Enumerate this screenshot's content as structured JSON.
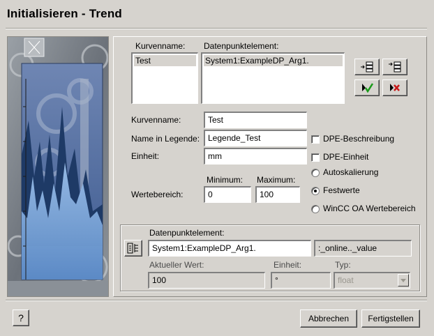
{
  "window": {
    "title": "Initialisieren - Trend"
  },
  "curves": {
    "col_name_label": "Kurvenname:",
    "col_dpe_label": "Datenpunktelement:",
    "name_items": [
      "Test"
    ],
    "dpe_items": [
      "System1:ExampleDP_Arg1."
    ]
  },
  "toolbar": {
    "insert_before_icon": "insert-row-above-icon",
    "insert_after_icon": "insert-row-below-icon",
    "accept_icon": "checkmark-icon",
    "delete_icon": "delete-x-icon"
  },
  "form": {
    "curve_name_label": "Kurvenname:",
    "curve_name_value": "Test",
    "legend_label": "Name in Legende:",
    "legend_value": "Legende_Test",
    "unit_label": "Einheit:",
    "unit_value": "mm",
    "range_label": "Wertebereich:",
    "min_label": "Minimum:",
    "min_value": "0",
    "max_label": "Maximum:",
    "max_value": "100"
  },
  "options": {
    "dpe_description": "DPE-Beschreibung",
    "dpe_unit": "DPE-Einheit",
    "autoscale": "Autoskalierung",
    "fixed_values": "Festwerte",
    "wincc_range": "WinCC OA Wertebereich",
    "selected_range_mode": "Festwerte"
  },
  "dpe_group": {
    "dpe_label": "Datenpunktelement:",
    "dpe_value": "System1:ExampleDP_Arg1.",
    "config_value": ":_online.._value",
    "current_value_label": "Aktueller Wert:",
    "current_value": "100",
    "unit_label": "Einheit:",
    "unit_value": "°",
    "type_label": "Typ:",
    "type_value": "float",
    "browse_icon": "dp-selector-icon"
  },
  "footer": {
    "help_label": "?",
    "cancel_label": "Abbrechen",
    "finish_label": "Fertigstellen"
  }
}
